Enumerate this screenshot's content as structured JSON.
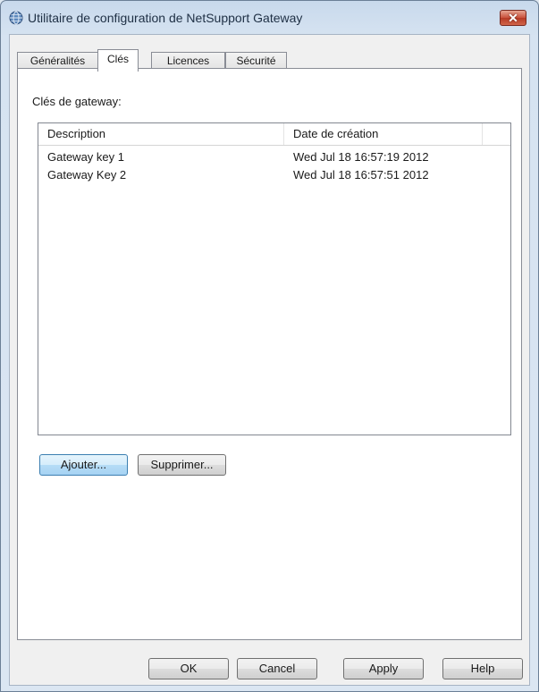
{
  "window": {
    "title": "Utilitaire de configuration de NetSupport Gateway",
    "close_label": "✕"
  },
  "tabs": [
    {
      "label": "Généralités"
    },
    {
      "label": "Clés"
    },
    {
      "label": "Licences"
    },
    {
      "label": "Sécurité"
    }
  ],
  "keys_tab": {
    "label": "Clés de gateway:",
    "columns": [
      "Description",
      "Date de création"
    ],
    "rows": [
      {
        "description": "Gateway key 1",
        "date": "Wed Jul 18 16:57:19 2012"
      },
      {
        "description": "Gateway Key 2",
        "date": "Wed Jul 18 16:57:51 2012"
      }
    ],
    "add_label": "Ajouter...",
    "delete_label": "Supprimer..."
  },
  "footer": {
    "ok": "OK",
    "cancel": "Cancel",
    "apply": "Apply",
    "help": "Help"
  },
  "icons": {
    "app": "globe-icon",
    "close": "close-icon"
  }
}
